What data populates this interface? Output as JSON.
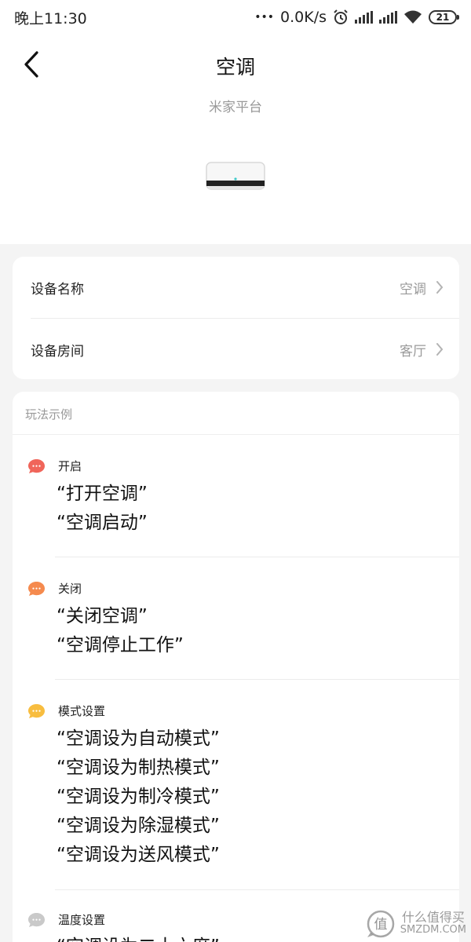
{
  "status_bar": {
    "time": "晚上11:30",
    "dots": "•••",
    "network_speed": "0.0K/s",
    "battery": "21"
  },
  "header": {
    "title": "空调",
    "subtitle": "米家平台",
    "back_icon": "chevron-left-icon",
    "device_icon": "air-conditioner-icon"
  },
  "settings": [
    {
      "label": "设备名称",
      "value": "空调"
    },
    {
      "label": "设备房间",
      "value": "客厅"
    }
  ],
  "examples": {
    "heading": "玩法示例",
    "groups": [
      {
        "label": "开启",
        "color": "#f0655a",
        "phrases": [
          "“打开空调”",
          "“空调启动”"
        ]
      },
      {
        "label": "关闭",
        "color": "#f58a4e",
        "phrases": [
          "“关闭空调”",
          "“空调停止工作”"
        ]
      },
      {
        "label": "模式设置",
        "color": "#f8bd3f",
        "phrases": [
          "“空调设为自动模式”",
          "“空调设为制热模式”",
          "“空调设为制冷模式”",
          "“空调设为除湿模式”",
          "“空调设为送风模式”"
        ]
      },
      {
        "label": "温度设置",
        "color": "#c9c9c9",
        "phrases": [
          "“空调设为二十六度”"
        ]
      }
    ]
  },
  "watermark": {
    "top": "什么值得买",
    "bottom": "SMZDM.COM",
    "logo_char": "值"
  }
}
